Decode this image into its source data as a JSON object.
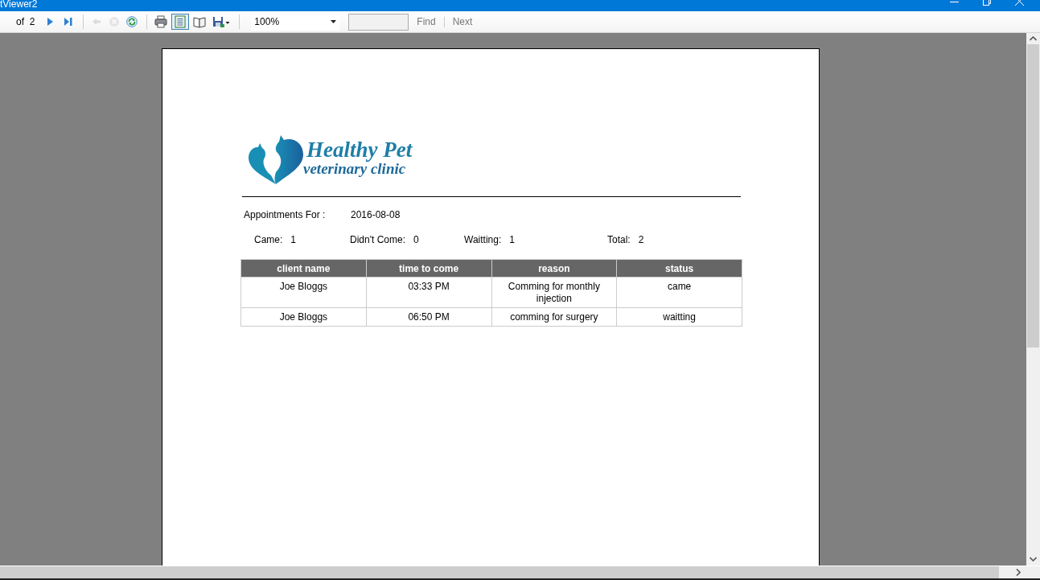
{
  "window": {
    "title": "tViewer2"
  },
  "toolbar": {
    "page_count": "of  2",
    "zoom": "100%",
    "find": "Find",
    "next": "Next",
    "buttons": [
      {
        "kind": "next",
        "disabled": false,
        "selected": false
      },
      {
        "kind": "last",
        "disabled": false,
        "selected": false
      },
      {
        "kind": "sep"
      },
      {
        "kind": "back",
        "disabled": true,
        "selected": false
      },
      {
        "kind": "stop",
        "disabled": true,
        "selected": false
      },
      {
        "kind": "refresh",
        "disabled": false,
        "selected": false
      },
      {
        "kind": "sep"
      },
      {
        "kind": "print",
        "disabled": false,
        "selected": false
      },
      {
        "kind": "layout",
        "disabled": false,
        "selected": true
      },
      {
        "kind": "setup",
        "disabled": false,
        "selected": false
      },
      {
        "kind": "export",
        "disabled": false,
        "selected": false
      }
    ]
  },
  "report": {
    "logo": {
      "name": "Healthy Pet",
      "tagline": "veterinary clinic"
    },
    "heading": {
      "label": "Appointments For :",
      "date": "2016-08-08"
    },
    "summary": [
      {
        "label": "Came:",
        "value": "1"
      },
      {
        "label": "Didn't Come:",
        "value": "0"
      },
      {
        "label": "Waitting:",
        "value": "1"
      },
      {
        "label": "Total:",
        "value": "2"
      }
    ],
    "table": {
      "columns": [
        "client name",
        "time to come",
        "reason",
        "status"
      ],
      "rows": [
        [
          "Joe Bloggs",
          "03:33 PM",
          "Comming for monthly injection",
          "came"
        ],
        [
          "Joe Bloggs",
          "06:50 PM",
          "comming for surgery",
          "waitting"
        ]
      ]
    }
  }
}
